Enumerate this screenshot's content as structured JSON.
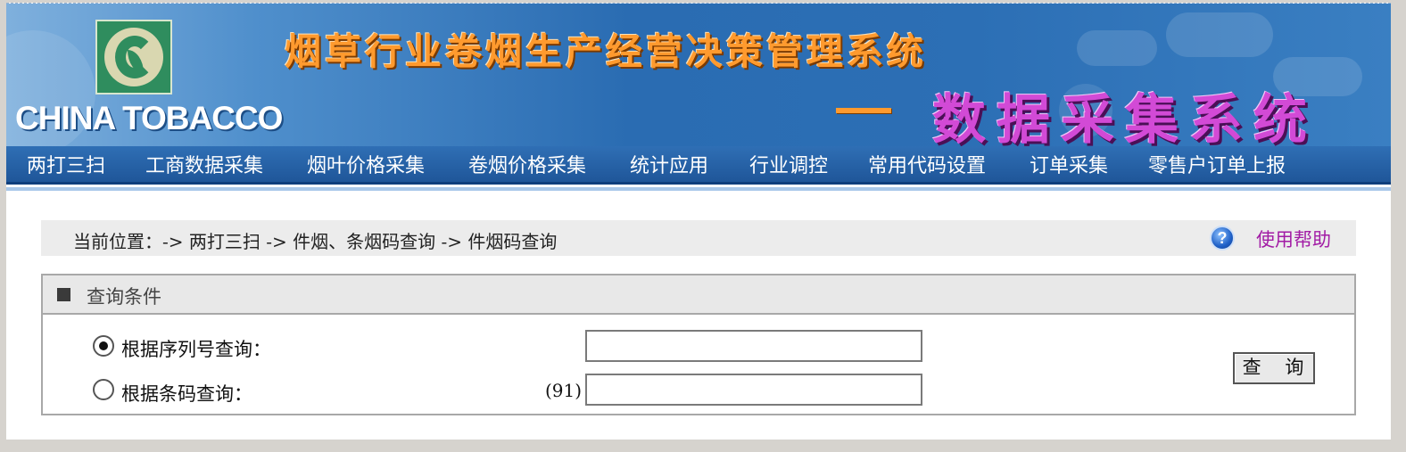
{
  "banner": {
    "brand_name": "CHINA TOBACCO",
    "system_title": "烟草行业卷烟生产经营决策管理系统",
    "sub_title": "数据采集系统",
    "title_color": "#ff9a2e",
    "subtitle_color": "#d24ad6"
  },
  "nav": {
    "items": [
      {
        "label": "两打三扫"
      },
      {
        "label": "工商数据采集"
      },
      {
        "label": "烟叶价格采集"
      },
      {
        "label": "卷烟价格采集"
      },
      {
        "label": "统计应用"
      },
      {
        "label": "行业调控"
      },
      {
        "label": "常用代码设置"
      },
      {
        "label": "订单采集"
      },
      {
        "label": "零售户订单上报"
      }
    ]
  },
  "breadcrumb": {
    "text": "当前位置：-> 两打三扫 -> 件烟、条烟码查询 -> 件烟码查询"
  },
  "help": {
    "icon": "help-question-icon",
    "label": "使用帮助",
    "color": "#a21ca5"
  },
  "query_panel": {
    "title": "查询条件",
    "options": [
      {
        "label": "根据序列号查询：",
        "checked": true,
        "prefix": "",
        "value": ""
      },
      {
        "label": "根据条码查询：",
        "checked": false,
        "prefix": "(91)",
        "value": ""
      }
    ],
    "submit_label": "查 询"
  }
}
